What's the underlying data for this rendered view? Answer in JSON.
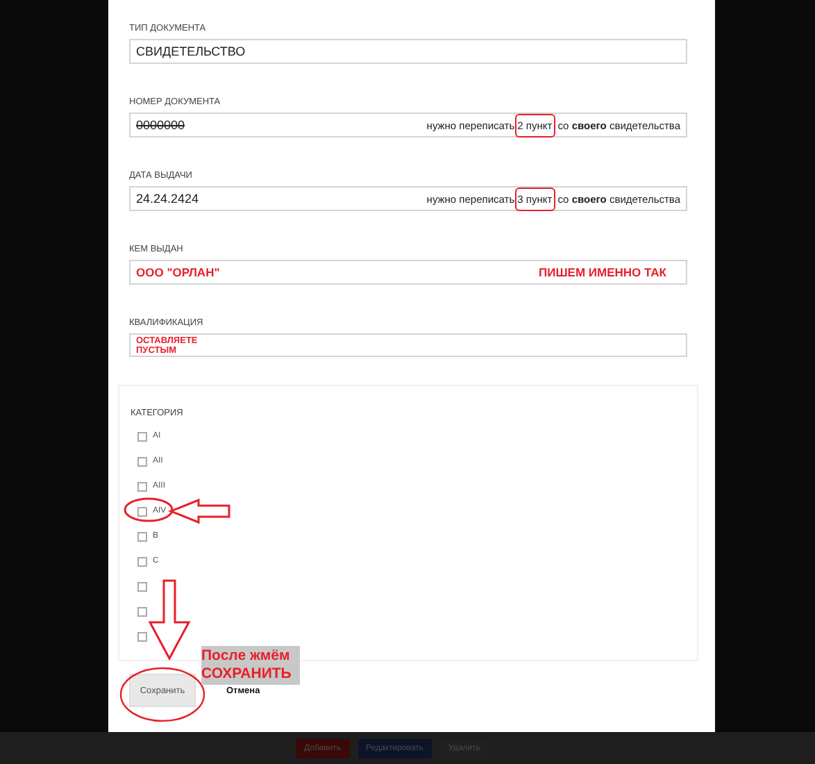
{
  "fields": [
    {
      "label": "ТИП ДОКУМЕНТА",
      "value": "СВИДЕТЕЛЬСТВО",
      "struck": false,
      "emphasis": false
    },
    {
      "label": "НОМЕР ДОКУМЕНТА",
      "value": "0000000",
      "struck": true,
      "emphasis": false,
      "note": {
        "before": "нужно переписать",
        "circled": "2 пункт",
        "after": "со **своего** свидетельства",
        "emphasis": false
      }
    },
    {
      "label": "ДАТА ВЫДАЧИ",
      "value": "24.24.2424",
      "struck": false,
      "emphasis": false,
      "note": {
        "before": "нужно переписать",
        "circled": "3 пункт",
        "after": "со **своего** свидетельства",
        "emphasis": false
      }
    },
    {
      "label": "КЕМ ВЫДАН",
      "value": "ООО \"ОРЛАН\"",
      "struck": false,
      "emphasis": true,
      "note": {
        "before": "ПИШЕМ ИМЕННО ТАК",
        "emphasis": true
      }
    },
    {
      "label": "КВАЛИФИКАЦИЯ",
      "value": "ОСТАВЛЯЕТЕ ПУСТЫМ",
      "struck": false,
      "emphasis": true,
      "small": true
    }
  ],
  "category": {
    "label": "КАТЕГОРИЯ",
    "items": [
      {
        "label": "AI",
        "checked": false
      },
      {
        "label": "AII",
        "checked": false
      },
      {
        "label": "AIII",
        "checked": false
      },
      {
        "label": "AIV",
        "checked": false
      },
      {
        "label": "B",
        "checked": false
      },
      {
        "label": "C",
        "checked": false
      },
      {
        "checked": false
      },
      {
        "checked": false
      },
      {
        "checked": false
      }
    ]
  },
  "buttons": {
    "save": "Сохранить",
    "cancel": "Отмена"
  },
  "annotation": {
    "text": "После жмём СОХРАНИТЬ"
  },
  "background_buttons": [
    {
      "label": "Добавить",
      "color": "#3a0808"
    },
    {
      "label": "Редактировать",
      "color": "#0c1428"
    },
    {
      "label": "Удалить",
      "color": "#202020"
    }
  ]
}
